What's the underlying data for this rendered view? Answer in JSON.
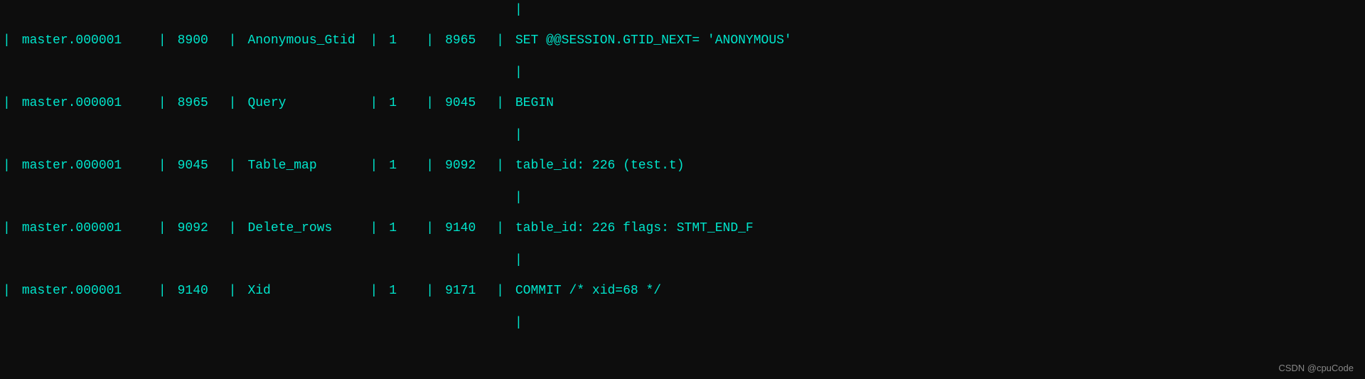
{
  "watermark": "CSDN @cpuCode",
  "rows": [
    {
      "log_name": "master.000001",
      "pos": "8900",
      "event_type": "Anonymous_Gtid",
      "server_id": "1",
      "end_log_pos": "8965",
      "info": "SET @@SESSION.GTID_NEXT= 'ANONYMOUS'"
    },
    {
      "log_name": "master.000001",
      "pos": "8965",
      "event_type": "Query",
      "server_id": "1",
      "end_log_pos": "9045",
      "info": "BEGIN"
    },
    {
      "log_name": "master.000001",
      "pos": "9045",
      "event_type": "Table_map",
      "server_id": "1",
      "end_log_pos": "9092",
      "info": "table_id: 226 (test.t)"
    },
    {
      "log_name": "master.000001",
      "pos": "9092",
      "event_type": "Delete_rows",
      "server_id": "1",
      "end_log_pos": "9140",
      "info": "table_id: 226 flags: STMT_END_F"
    },
    {
      "log_name": "master.000001",
      "pos": "9140",
      "event_type": "Xid",
      "server_id": "1",
      "end_log_pos": "9171",
      "info": "COMMIT /* xid=68 */"
    }
  ]
}
